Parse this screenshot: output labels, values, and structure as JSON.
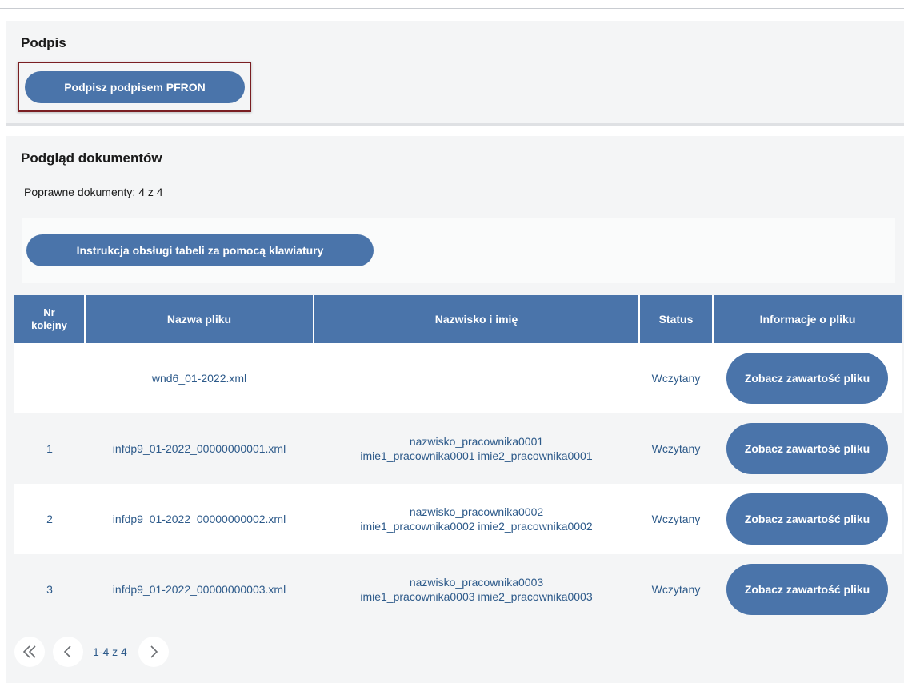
{
  "signature": {
    "title": "Podpis",
    "sign_button": "Podpisz podpisem PFRON"
  },
  "documents": {
    "title": "Podgląd dokumentów",
    "valid_count": "Poprawne dokumenty: 4 z 4",
    "keyboard_instructions_button": "Instrukcja obsługi tabeli za pomocą klawiatury",
    "columns": [
      "Nr kolejny",
      "Nazwa pliku",
      "Nazwisko i imię",
      "Status",
      "Informacje o pliku"
    ],
    "rows": [
      {
        "nr": "",
        "file": "wnd6_01-2022.xml",
        "surname": "",
        "names": "",
        "status": "Wczytany",
        "action": "Zobacz zawartość pliku"
      },
      {
        "nr": "1",
        "file": "infdp9_01-2022_00000000001.xml",
        "surname": "nazwisko_pracownika0001",
        "names": "imie1_pracownika0001 imie2_pracownika0001",
        "status": "Wczytany",
        "action": "Zobacz zawartość pliku"
      },
      {
        "nr": "2",
        "file": "infdp9_01-2022_00000000002.xml",
        "surname": "nazwisko_pracownika0002",
        "names": "imie1_pracownika0002 imie2_pracownika0002",
        "status": "Wczytany",
        "action": "Zobacz zawartość pliku"
      },
      {
        "nr": "3",
        "file": "infdp9_01-2022_00000000003.xml",
        "surname": "nazwisko_pracownika0003",
        "names": "imie1_pracownika0003 imie2_pracownika0003",
        "status": "Wczytany",
        "action": "Zobacz zawartość pliku"
      }
    ]
  },
  "pagination": {
    "range": "1-4 z 4",
    "first_icon": "double-chevron-left-icon",
    "prev_icon": "chevron-left-icon",
    "next_icon": "chevron-right-icon"
  },
  "colors": {
    "accent": "#4a74aa",
    "focus_outline": "#7a1e22",
    "panel_bg": "#f4f5f6"
  }
}
